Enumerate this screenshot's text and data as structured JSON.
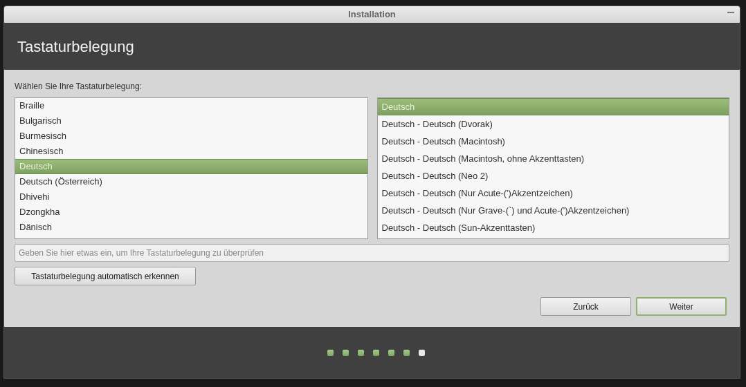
{
  "window": {
    "title": "Installation",
    "minimize_button": true
  },
  "header": {
    "title": "Tastaturbelegung"
  },
  "prompt": "Wählen Sie Ihre Tastaturbelegung:",
  "layouts": [
    {
      "label": "Braille",
      "selected": false
    },
    {
      "label": "Bulgarisch",
      "selected": false
    },
    {
      "label": "Burmesisch",
      "selected": false
    },
    {
      "label": "Chinesisch",
      "selected": false
    },
    {
      "label": "Deutsch",
      "selected": true
    },
    {
      "label": "Deutsch (Österreich)",
      "selected": false
    },
    {
      "label": "Dhivehi",
      "selected": false
    },
    {
      "label": "Dzongkha",
      "selected": false
    },
    {
      "label": "Dänisch",
      "selected": false
    }
  ],
  "variants": [
    {
      "label": "Deutsch",
      "selected": true
    },
    {
      "label": "Deutsch - Deutsch (Dvorak)",
      "selected": false
    },
    {
      "label": "Deutsch - Deutsch (Macintosh)",
      "selected": false
    },
    {
      "label": "Deutsch - Deutsch (Macintosh, ohne Akzenttasten)",
      "selected": false
    },
    {
      "label": "Deutsch - Deutsch (Neo 2)",
      "selected": false
    },
    {
      "label": "Deutsch - Deutsch (Nur Acute-(')Akzentzeichen)",
      "selected": false
    },
    {
      "label": "Deutsch - Deutsch (Nur Grave-(`) und Acute-(')Akzentzeichen)",
      "selected": false
    },
    {
      "label": "Deutsch - Deutsch (Sun-Akzenttasten)",
      "selected": false
    }
  ],
  "test_field": {
    "placeholder": "Geben Sie hier etwas ein, um Ihre Tastaturbelegung zu überprüfen"
  },
  "detect_button": "Tastaturbelegung automatisch erkennen",
  "nav_buttons": [
    {
      "label": "Zurück",
      "default": false
    },
    {
      "label": "Weiter",
      "default": true
    }
  ],
  "progress": [
    {
      "done": true
    },
    {
      "done": true
    },
    {
      "done": true
    },
    {
      "done": true
    },
    {
      "done": true
    },
    {
      "done": true
    },
    {
      "done": false
    }
  ]
}
